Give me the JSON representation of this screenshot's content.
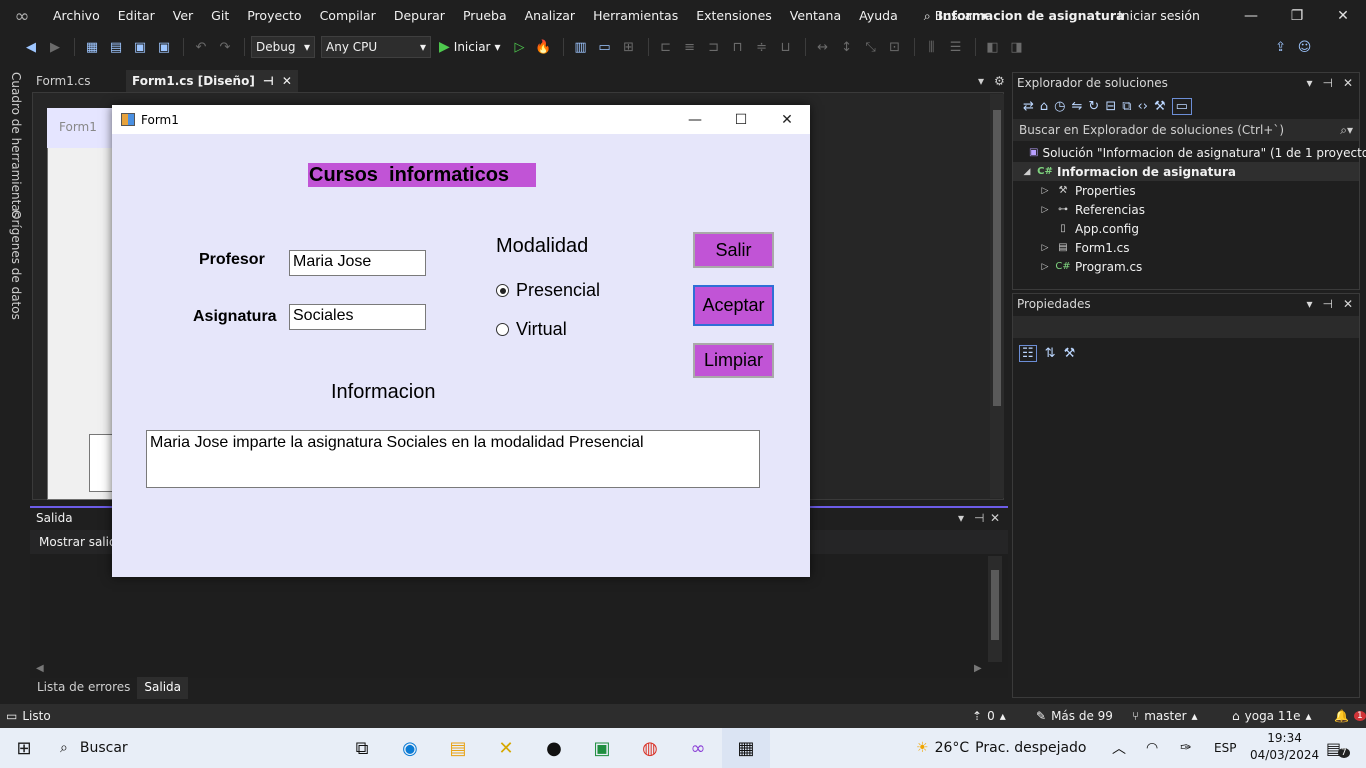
{
  "menu": {
    "items": [
      "Archivo",
      "Editar",
      "Ver",
      "Git",
      "Proyecto",
      "Compilar",
      "Depurar",
      "Prueba",
      "Analizar",
      "Herramientas",
      "Extensiones",
      "Ventana",
      "Ayuda"
    ],
    "search_label": "Buscar",
    "app_title": "Informacion de asignatura",
    "signin": "Iniciar sesión"
  },
  "toolbar": {
    "config": "Debug",
    "platform": "Any CPU",
    "run_label": "Iniciar"
  },
  "left_tabs": {
    "toolbox": "Cuadro de herramientas",
    "datasources": "Orígenes de datos"
  },
  "doc_tabs": [
    {
      "label": "Form1.cs"
    },
    {
      "label": "Form1.cs [Diseño]"
    }
  ],
  "designer": {
    "bg_form_title": "Form1"
  },
  "output": {
    "title": "Salida",
    "show_from": "Mostrar salida"
  },
  "bottom_tabs": [
    "Lista de errores",
    "Salida"
  ],
  "solution_explorer": {
    "title": "Explorador de soluciones",
    "search_placeholder": "Buscar en Explorador de soluciones (Ctrl+`)",
    "solution": "Solución \"Informacion de asignatura\"  (1 de 1 proyecto)",
    "project": "Informacion de asignatura",
    "items": [
      "Properties",
      "Referencias",
      "App.config",
      "Form1.cs",
      "Program.cs"
    ]
  },
  "properties": {
    "title": "Propiedades"
  },
  "statusbar": {
    "status": "Listo",
    "errors": "0",
    "changes": "Más de 99",
    "branch": "master",
    "repo": "yoga 11e",
    "notifications": "1"
  },
  "taskbar": {
    "search": "Buscar",
    "weather_temp": "26°C",
    "weather_desc": "Prac. despejado",
    "lang": "ESP",
    "time": "19:34",
    "date": "04/03/2024",
    "notif_count": "7"
  },
  "form1": {
    "title": "Form1",
    "heading": "Cursos  informaticos",
    "profesor_label": "Profesor",
    "profesor_value": "Maria Jose",
    "asignatura_label": "Asignatura",
    "asignatura_value": "Sociales",
    "modalidad_label": "Modalidad",
    "radio_presencial": "Presencial",
    "radio_virtual": "Virtual",
    "btn_salir": "Salir",
    "btn_aceptar": "Aceptar",
    "btn_limpiar": "Limpiar",
    "info_label": "Informacion",
    "info_text": "Maria Jose imparte la asignatura Sociales en la modalidad Presencial"
  },
  "colors": {
    "accent_purple": "#c154d6",
    "form_bg": "#e6e6fa",
    "vs_dark": "#1f1f1f"
  }
}
